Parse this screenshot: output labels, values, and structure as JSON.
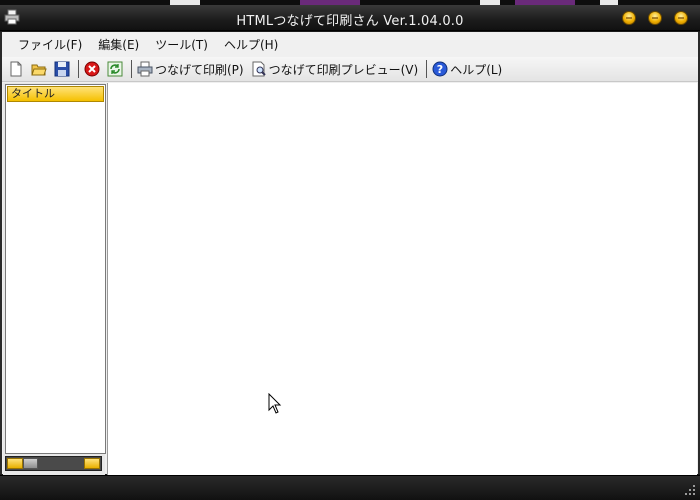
{
  "window": {
    "title": "HTMLつなげて印刷さん Ver.1.04.0.0"
  },
  "menubar": {
    "items": [
      {
        "label": "ファイル(F)"
      },
      {
        "label": "編集(E)"
      },
      {
        "label": "ツール(T)"
      },
      {
        "label": "ヘルプ(H)"
      }
    ]
  },
  "toolbar": {
    "buttons": [
      {
        "icon": "new-file-icon"
      },
      {
        "icon": "open-folder-icon"
      },
      {
        "icon": "save-icon"
      },
      {
        "icon": "stop-icon"
      },
      {
        "icon": "refresh-icon"
      },
      {
        "icon": "print-icon",
        "label": "つなげて印刷(P)"
      },
      {
        "icon": "print-preview-icon",
        "label": "つなげて印刷プレビュー(V)"
      },
      {
        "icon": "help-icon",
        "label": "ヘルプ(L)"
      }
    ]
  },
  "sidebar": {
    "column_header": "タイトル"
  },
  "colors": {
    "accent_gold": "#f5c000",
    "titlebar_dark": "#1c1c1c"
  }
}
